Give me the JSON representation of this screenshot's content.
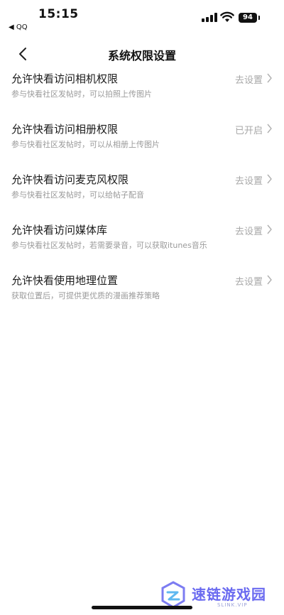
{
  "status_bar": {
    "time": "15:15",
    "back_app": "◀ QQ",
    "battery": "94"
  },
  "nav": {
    "title": "系统权限设置"
  },
  "permissions": [
    {
      "title": "允许快看访问相机权限",
      "desc": "参与快看社区发帖时，可以拍照上传图片",
      "status": "去设置"
    },
    {
      "title": "允许快看访问相册权限",
      "desc": "参与快看社区发帖时，可以从相册上传图片",
      "status": "已开启"
    },
    {
      "title": "允许快看访问麦克风权限",
      "desc": "参与快看社区发帖时，可以给帖子配音",
      "status": "去设置"
    },
    {
      "title": "允许快看访问媒体库",
      "desc": "参与快看社区发帖时，若需要录音，可以获取itunes音乐",
      "status": "去设置"
    },
    {
      "title": "允许快看使用地理位置",
      "desc": "获取位置后，可提供更优质的漫画推荐策略",
      "status": "去设置"
    }
  ],
  "watermark": {
    "name": "速链游戏园",
    "sub": "SLINK.VIP"
  },
  "colors": {
    "accent": "#6a6af0",
    "muted": "#9a9a9a"
  }
}
